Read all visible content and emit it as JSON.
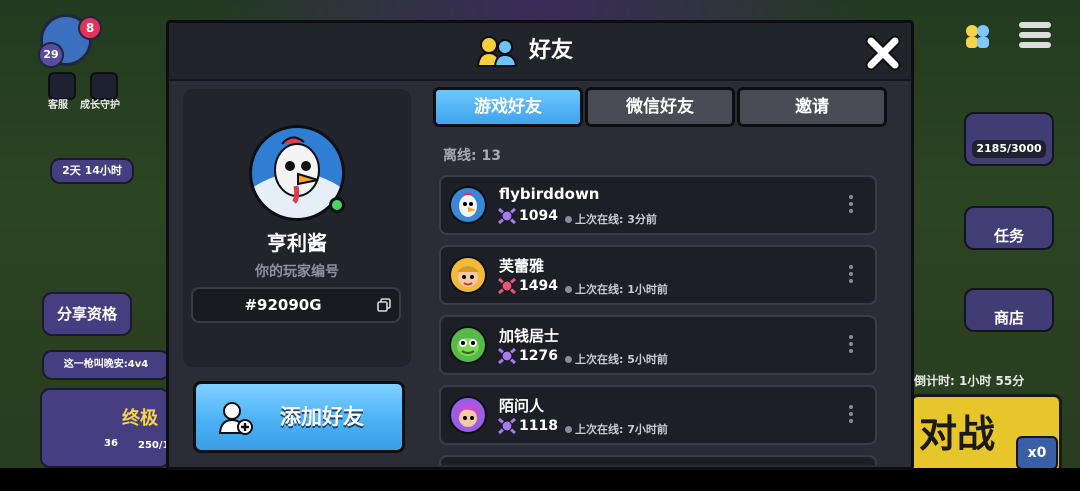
{
  "background": {
    "level": "29",
    "notification_count": "8",
    "customer_service": "客服",
    "growth_guard": "成长守护",
    "event_timer": "2天 14小时",
    "share_label": "分享资格",
    "chat_preview": "这一枪叫晚安:4v4",
    "rank_label": "终极",
    "rank_level": "36",
    "rank_progress": "250/1",
    "gem_progress": "2185/3000",
    "tasks_label": "任务",
    "shop_label": "商店",
    "countdown": "倒计时: 1小时 55分",
    "battle_label": "对战",
    "ticket_count": "x0"
  },
  "modal": {
    "title": "好友",
    "profile": {
      "name": "亨利酱",
      "id_label": "你的玩家编号",
      "player_id": "#92090G"
    },
    "add_friend_label": "添加好友",
    "tabs": [
      {
        "label": "游戏好友",
        "active": true
      },
      {
        "label": "微信好友",
        "active": false
      },
      {
        "label": "邀请",
        "active": false
      }
    ],
    "offline_label": "离线: 13",
    "friends": [
      {
        "name": "flybirddown",
        "score": "1094",
        "last_online": "上次在线: 3分前"
      },
      {
        "name": "芙蕾雅",
        "score": "1494",
        "last_online": "上次在线: 1小时前"
      },
      {
        "name": "加钱居士",
        "score": "1276",
        "last_online": "上次在线: 5小时前"
      },
      {
        "name": "陌问人",
        "score": "1118",
        "last_online": "上次在线: 7小时前"
      }
    ]
  },
  "colors": {
    "accent_blue": "#4cb2f5",
    "online_green": "#4ad36b",
    "trophy_purple": "#a57cf0"
  }
}
